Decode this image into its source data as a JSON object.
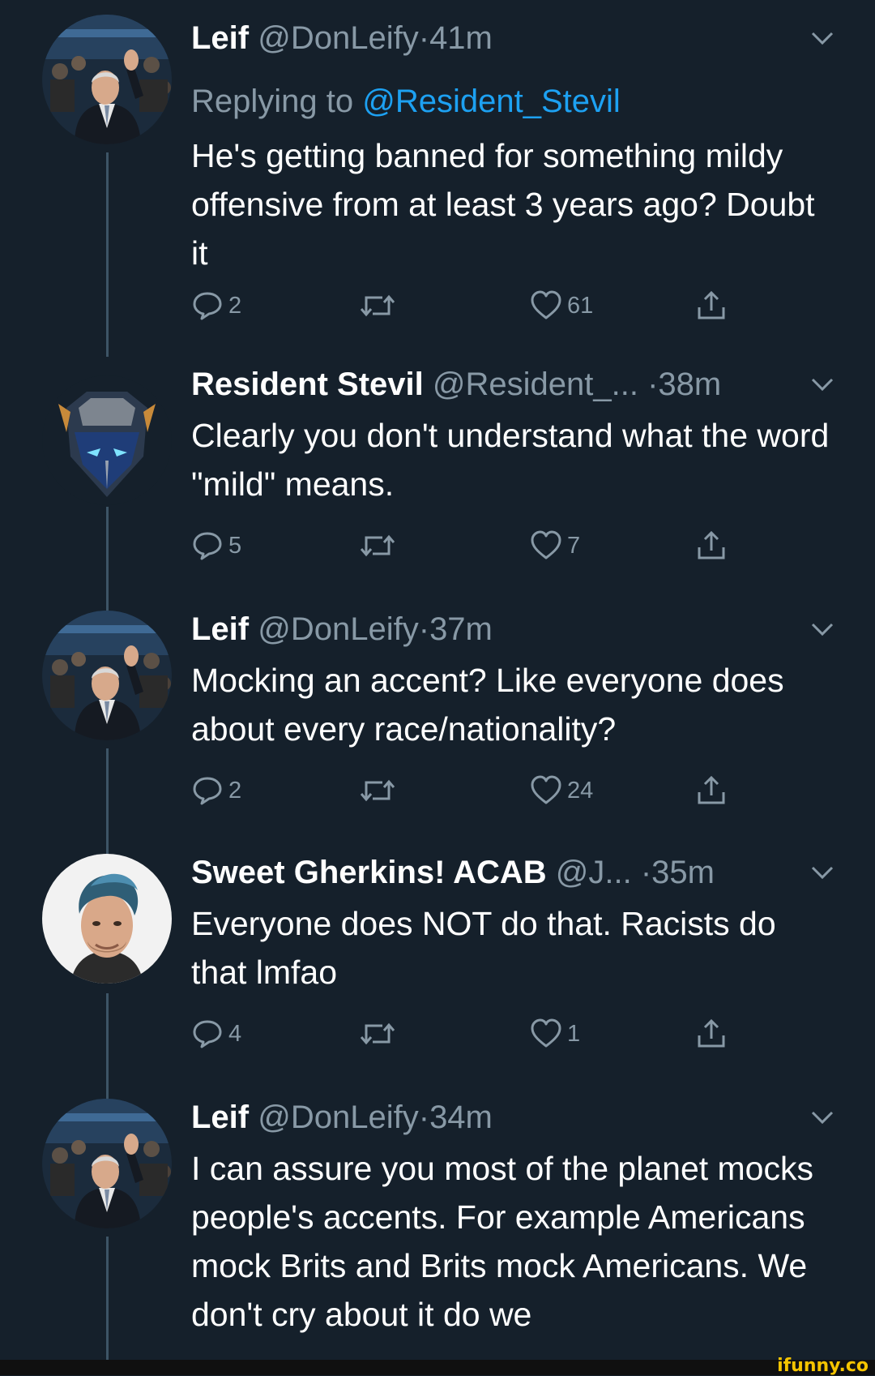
{
  "colors": {
    "background": "#15202b",
    "text": "#ffffff",
    "secondary": "#8899a6",
    "link": "#1da1f2",
    "thread_line": "#3d5466",
    "watermark": "#f5c400"
  },
  "tweets": [
    {
      "name": "Leif",
      "handle": "@DonLeify",
      "time": "41m",
      "separator": "·",
      "replying_label": "Replying to",
      "replying_to": "@Resident_Stevil",
      "text": "He's getting banned for something mildy offensive from at least 3 years ago? Doubt it",
      "replies": "2",
      "likes": "61",
      "avatar": "man-waving-avatar"
    },
    {
      "name": "Resident Stevil",
      "handle": "@Resident_...",
      "time": "38m",
      "separator": "·",
      "text": "Clearly you don't understand what the word \"mild\" means.",
      "replies": "5",
      "likes": "7",
      "avatar": "robot-helmet-avatar"
    },
    {
      "name": "Leif",
      "handle": "@DonLeify",
      "time": "37m",
      "separator": "·",
      "text": "Mocking an accent? Like everyone does about every race/nationality?",
      "replies": "2",
      "likes": "24",
      "avatar": "man-waving-avatar"
    },
    {
      "name": "Sweet Gherkins! ACAB",
      "handle": "@J...",
      "time": "35m",
      "separator": "·",
      "text": "Everyone does NOT do that. Racists do that lmfao",
      "replies": "4",
      "likes": "1",
      "avatar": "young-man-portrait-avatar"
    },
    {
      "name": "Leif",
      "handle": "@DonLeify",
      "time": "34m",
      "separator": "·",
      "text": "I can assure you most of the planet mocks people's accents. For example Americans mock Brits and Brits mock Americans. We don't cry about it do we",
      "avatar": "man-waving-avatar"
    }
  ],
  "icons": {
    "reply": "reply-bubble-icon",
    "retweet": "retweet-icon",
    "like": "heart-icon",
    "share": "share-icon",
    "menu": "chevron-down-icon"
  },
  "watermark": "ifunny.co"
}
